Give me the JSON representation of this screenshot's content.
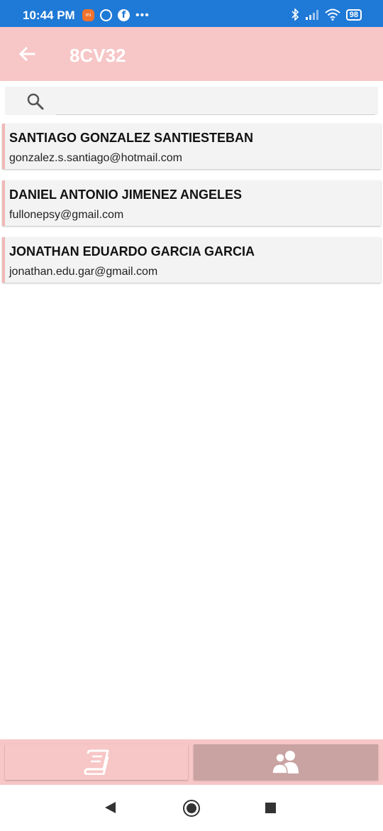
{
  "status_bar": {
    "time": "10:44 PM",
    "battery": "98",
    "icons": [
      "mi-icon",
      "circle-icon",
      "facebook-icon",
      "more-dots-icon",
      "bluetooth-icon",
      "signal-icon",
      "wifi-icon",
      "battery-icon"
    ]
  },
  "app_bar": {
    "title": "8CV32",
    "back_icon": "arrow-left-icon",
    "background": "#f7c6c6"
  },
  "search": {
    "placeholder": "",
    "value": "",
    "icon": "search-icon"
  },
  "contacts": [
    {
      "name": "SANTIAGO GONZALEZ SANTIESTEBAN",
      "email": "gonzalez.s.santiago@hotmail.com"
    },
    {
      "name": "DANIEL ANTONIO JIMENEZ ANGELES",
      "email": "fullonepsy@gmail.com"
    },
    {
      "name": "JONATHAN EDUARDO GARCIA GARCIA",
      "email": "jonathan.edu.gar@gmail.com"
    }
  ],
  "bottom_tabs": [
    {
      "icon": "book-icon",
      "selected": false
    },
    {
      "icon": "users-icon",
      "selected": true
    }
  ],
  "colors": {
    "status_bar": "#1f79d6",
    "accent": "#f7c6c6",
    "tab_selected": "#c9a2a2",
    "card_border": "#f0b8b8"
  }
}
